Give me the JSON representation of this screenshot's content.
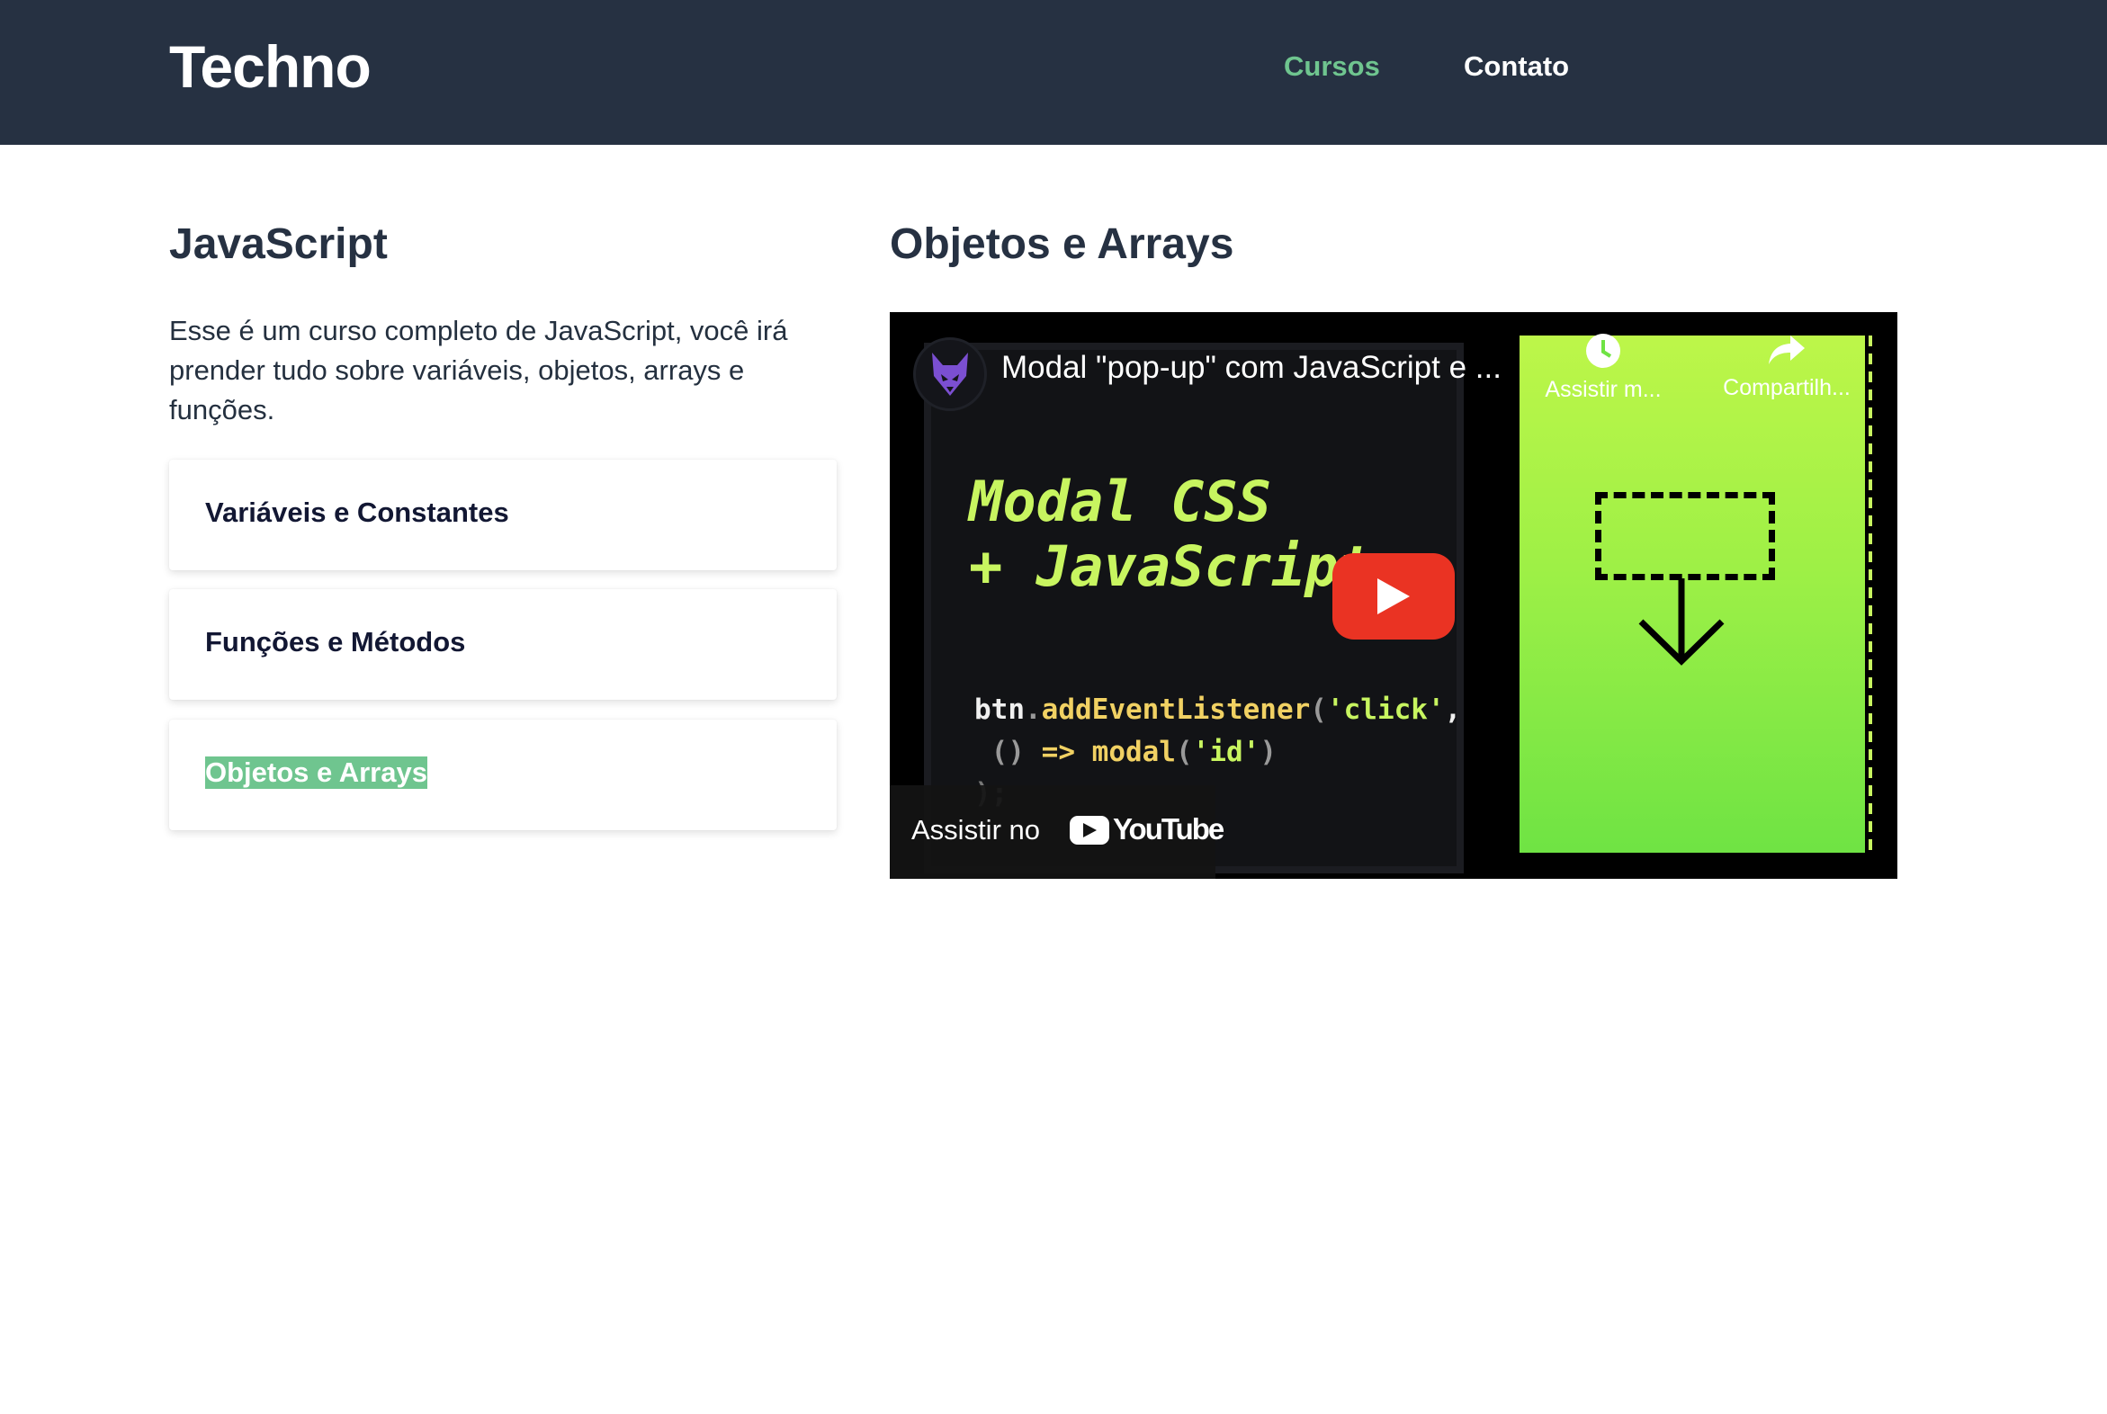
{
  "header": {
    "logo": "Techno",
    "nav": [
      {
        "label": "Cursos",
        "active": true
      },
      {
        "label": "Contato",
        "active": false
      }
    ]
  },
  "course": {
    "title": "JavaScript",
    "description": "Esse é um curso completo de JavaScript, você irá prender tudo sobre variáveis, objetos, arrays e funções.",
    "lessons": [
      {
        "label": "Variáveis e Constantes",
        "selected": false
      },
      {
        "label": "Funções e Métodos",
        "selected": false
      },
      {
        "label": "Objetos e Arrays",
        "selected": true
      }
    ]
  },
  "lesson": {
    "heading": "Objetos e Arrays",
    "video": {
      "title": "Modal \"pop-up\" com JavaScript e ...",
      "watch_later": "Assistir m...",
      "share": "Compartilh...",
      "watch_on": "Assistir no",
      "youtube": "YouTube",
      "thumbnail": {
        "headline_1": "Modal CSS",
        "headline_2": "+ JavaScript",
        "code": {
          "obj": "btn",
          "dot": ".",
          "method": "addEventListener",
          "open_paren": "(",
          "event": "'click'",
          "comma": ",",
          "line2_prefix": " () ",
          "arrow": "=>",
          "fn": "modal",
          "arg": "'id'",
          "line3": ");"
        }
      }
    }
  },
  "colors": {
    "header_bg": "#263142",
    "accent": "#6fc58f",
    "youtube_red": "#ea3323",
    "code_green": "#c8f560"
  },
  "icons": [
    "clock-icon",
    "share-icon",
    "play-icon",
    "youtube-logo-icon",
    "channel-avatar"
  ]
}
